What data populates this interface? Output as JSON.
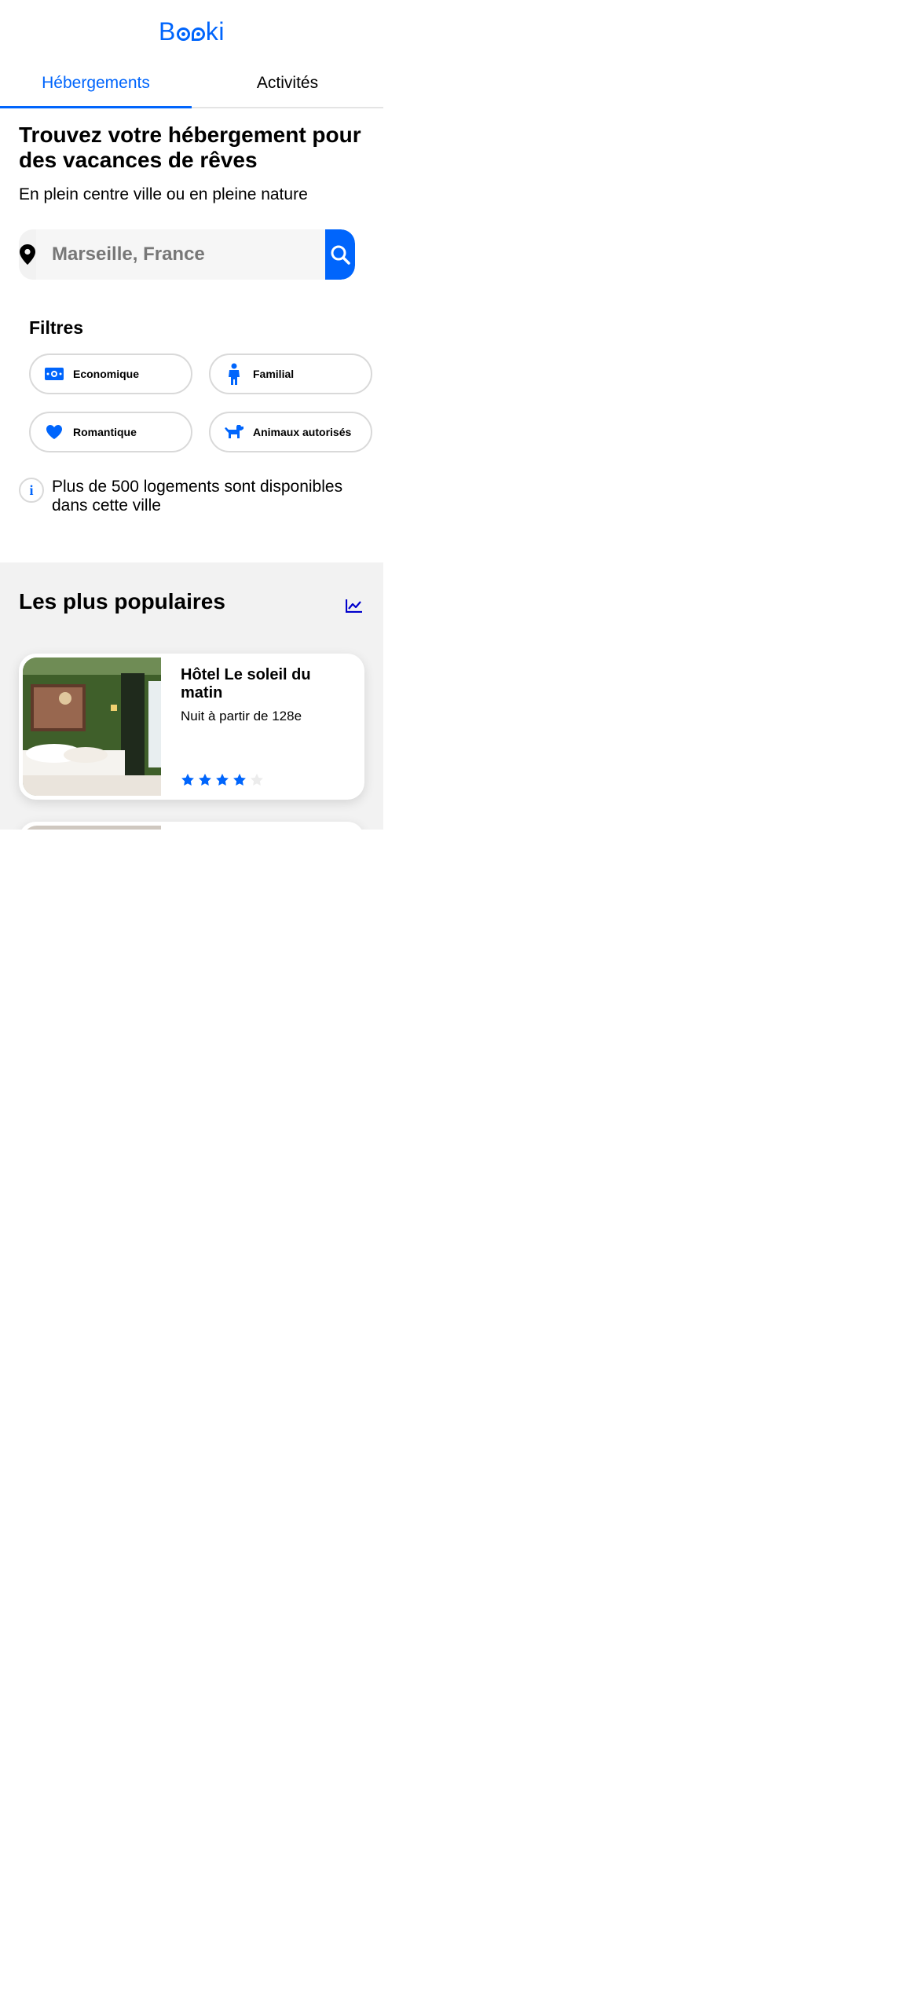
{
  "app": {
    "logo_prefix": "B",
    "logo_suffix": "ki"
  },
  "tabs": [
    {
      "label": "Hébergements",
      "active": true
    },
    {
      "label": "Activités",
      "active": false
    }
  ],
  "hero": {
    "title": "Trouvez votre hébergement pour des vacances de rêves",
    "subtitle": "En plein centre ville ou en pleine nature"
  },
  "search": {
    "placeholder": "Marseille, France",
    "value": ""
  },
  "filters": {
    "title": "Filtres",
    "items": [
      {
        "label": "Economique",
        "icon": "money-icon"
      },
      {
        "label": "Familial",
        "icon": "child-icon"
      },
      {
        "label": "Romantique",
        "icon": "heart-icon"
      },
      {
        "label": "Animaux autorisés",
        "icon": "dog-icon"
      }
    ]
  },
  "info": {
    "text": "Plus de 500 logements sont disponibles dans cette ville"
  },
  "popular": {
    "title": "Les plus populaires",
    "cards": [
      {
        "name": "Hôtel Le soleil du matin",
        "price": "Nuit à partir de 128e",
        "rating": 4,
        "max_rating": 5
      }
    ]
  },
  "colors": {
    "accent": "#0065FC",
    "section_bg": "#F2F2F2"
  }
}
